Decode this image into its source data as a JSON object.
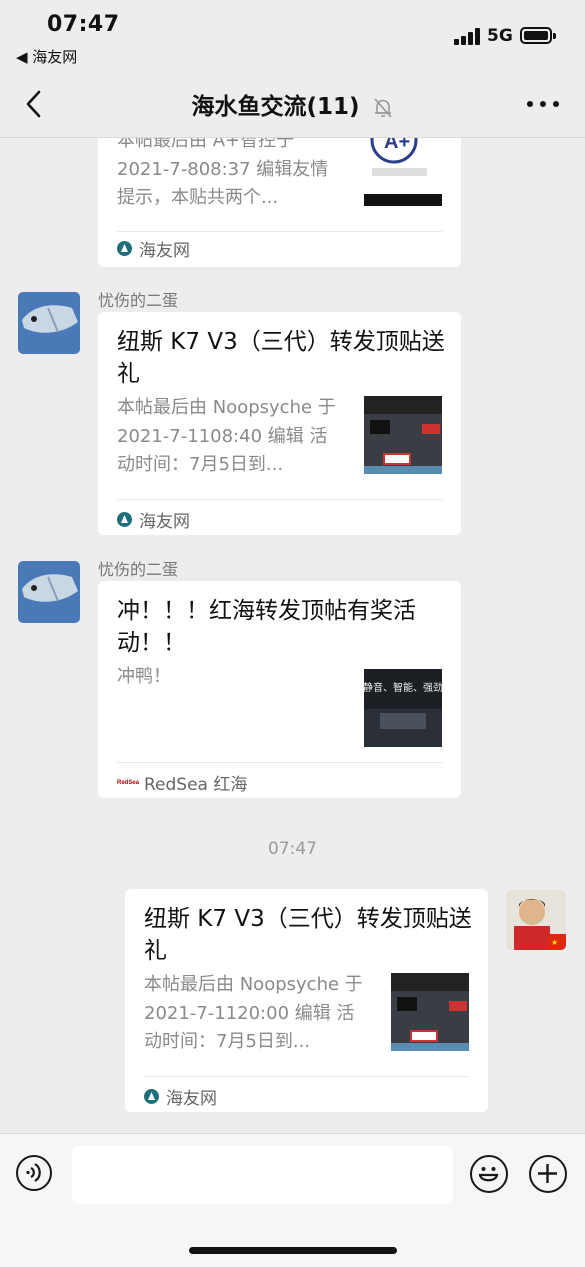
{
  "status_bar": {
    "time": "07:47",
    "back_app": "◀ 海友网",
    "network": "5G"
  },
  "nav": {
    "title": "海水鱼交流(11)"
  },
  "messages": [
    {
      "title": "",
      "desc": "本帖最后由 A+智控于2021-7-808:37 编辑友情提示，本贴共两个...",
      "source": "海友网"
    },
    {
      "sender": "忧伤的二蛋",
      "title": "纽斯 K7 V3（三代）转发顶贴送礼",
      "desc": "本帖最后由 Noopsyche 于 2021-7-1108:40 编辑 活动时间：7月5日到...",
      "source": "海友网"
    },
    {
      "sender": "忧伤的二蛋",
      "title": "冲！！！红海转发顶帖有奖活动！！",
      "desc": "冲鸭！",
      "thumb_text": "静音、智能、强劲",
      "source": "RedSea 红海",
      "source_logo": "RedSea"
    },
    {
      "title": "纽斯 K7 V3（三代）转发顶贴送礼",
      "desc": "本帖最后由 Noopsyche 于 2021-7-1120:00 编辑 活动时间：7月5日到...",
      "source": "海友网"
    }
  ],
  "timestamp": "07:47",
  "input": {
    "placeholder": ""
  }
}
